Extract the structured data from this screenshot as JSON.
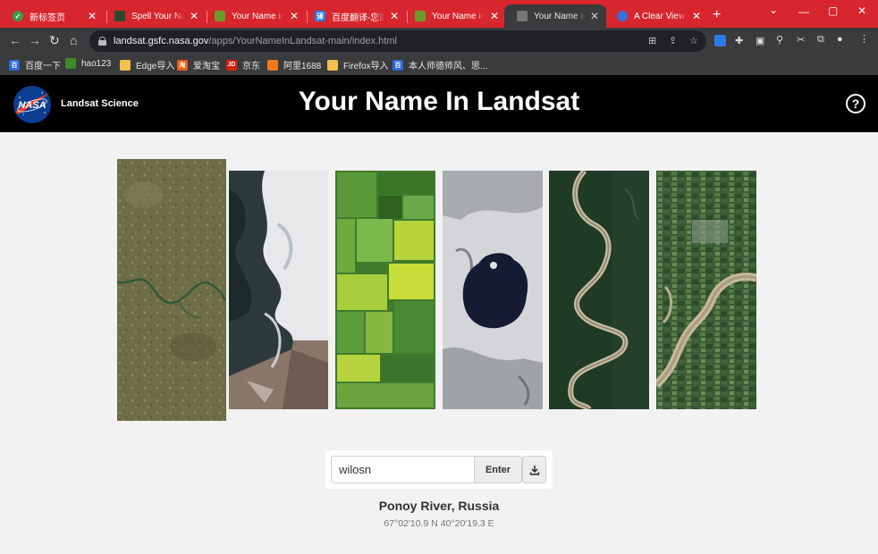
{
  "browser": {
    "tabs": [
      {
        "title": "新标签页",
        "favicon": "shield-icon",
        "color": "#4caf50"
      },
      {
        "title": "Spell Your Name",
        "favicon": "landsat-icon",
        "color": "#2b4a2b"
      },
      {
        "title": "Your Name in L",
        "favicon": "landsat-icon",
        "color": "#5a8a2a"
      },
      {
        "title": "百度翻译-您的超",
        "favicon": "translate-icon",
        "color": "#2d7be5"
      },
      {
        "title": "Your Name in L",
        "favicon": "landsat-icon",
        "color": "#5a8a2a"
      },
      {
        "title": "Your Name in L",
        "favicon": "landsat-icon",
        "color": "#888888",
        "active": true
      },
      {
        "title": "A Clear View of",
        "favicon": "globe-icon",
        "color": "#3b6fd8"
      }
    ],
    "url_host": "landsat.gsfc.nasa.gov",
    "url_path": "/apps/YourNameInLandsat-main/index.html",
    "bookmarks": [
      {
        "label": "百度一下",
        "color": "#2d68d8"
      },
      {
        "label": "hao123",
        "color": "#3d8a2a"
      },
      {
        "label": "Edge导入",
        "color": "#f2c14e"
      },
      {
        "label": "爱淘宝",
        "color": "#f05a1a"
      },
      {
        "label": "京东",
        "color": "#d81e06"
      },
      {
        "label": "阿里1688",
        "color": "#f07a1a"
      },
      {
        "label": "Firefox导入",
        "color": "#f2c14e"
      },
      {
        "label": "本人师德师风、思...",
        "color": "#2d68d8"
      }
    ]
  },
  "header": {
    "logo_text": "NASA",
    "brand": "Landsat Science",
    "title": "Your Name In Landsat",
    "help_symbol": "?"
  },
  "letters": [
    {
      "letter": "w",
      "description": "olive steppe with winding river"
    },
    {
      "letter": "i",
      "description": "coastline with ice"
    },
    {
      "letter": "l",
      "description": "green agricultural fields"
    },
    {
      "letter": "o",
      "description": "lake surrounded by snow"
    },
    {
      "letter": "s",
      "description": "meandering river through forest"
    },
    {
      "letter": "n",
      "description": "river through farmland"
    }
  ],
  "input": {
    "value": "wilosn",
    "enter_label": "Enter"
  },
  "location": {
    "name": "Ponoy River, Russia",
    "coords": "67°02'10.9 N 40°20'19.3 E"
  }
}
